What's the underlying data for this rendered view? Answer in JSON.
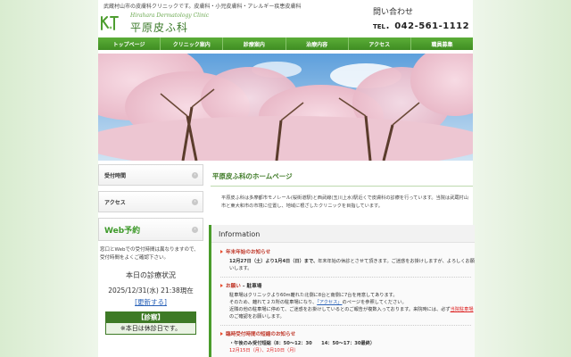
{
  "header": {
    "tagline": "武蔵村山市の皮膚科クリニックです。皮膚科・小児皮膚科・アレルギー疾患皮膚科",
    "logo_en": "Hirahara Dermatology Clinic",
    "logo_jp": "平原皮ふ科",
    "contact_label": "問い合わせ",
    "tel_prefix": "TEL",
    "tel_number": "042-561-1112"
  },
  "nav": {
    "items": [
      "トップページ",
      "クリニック案内",
      "診療案内",
      "治療内容",
      "アクセス",
      "職員募集"
    ]
  },
  "sidebar": {
    "hours_label": "受付時間",
    "access_label": "アクセス",
    "web_label": "Web予約",
    "note": "窓口とWebでの受付時間は異なりますので、受付時間をよくご確認下さい。",
    "status_title": "本日の診療状況",
    "status_time": "2025/12/31(水) 21:38現在",
    "refresh_label": "[更新する]",
    "status_head": "【診察】",
    "status_body": "※本日は休診日です。"
  },
  "main": {
    "title": "平原皮ふ科のホームページ",
    "intro": "平原皮ふ科は多摩都市モノレール(桜街道駅)と西武線(玉川上水)駅近くで皮膚科の診療を行っています。当院は武蔵村山市と東大和市の市境に位置し、地域に根ざしたクリニックを目指しています。",
    "info_heading": "Information",
    "news": [
      {
        "title": "年末年始のお知らせ",
        "body_bold": "12月27日（土）より1月4日（日）まで、",
        "body_rest": "年末年始の休診とさせて頂きます。ご迷惑をお掛けしますが、よろしくお願いします。"
      },
      {
        "title_red": "お願い",
        "title_dash": "–",
        "title_rest": "駐車場",
        "body_1": "駐車場はクリニックより60m離れた北側に8台と南側に7台を用意してあります。",
        "body_2": "そのため、離れて２カ所の駐車場になり、",
        "body_link": "「アクセス」",
        "body_3": "のページを参照してください。",
        "body_4": "近隣の他の駐車場に停めて、ご迷惑をお掛けしているとのご報告が複数入っております。来院時には、必ず",
        "body_red": "当院駐車場",
        "body_5": "のご確認をお願いします。"
      },
      {
        "title": "臨時受付時間の短縮のお知らせ",
        "body_1": "・午後のみ受付短縮（8：50〜12：30　　14：50〜17：30最終）",
        "body_2": "12月15日（月）、2月10日（月）"
      }
    ]
  },
  "colors": {
    "brand_green": "#3e7a26",
    "nav_green": "#4f9e2e",
    "alert_red": "#c0392b"
  }
}
